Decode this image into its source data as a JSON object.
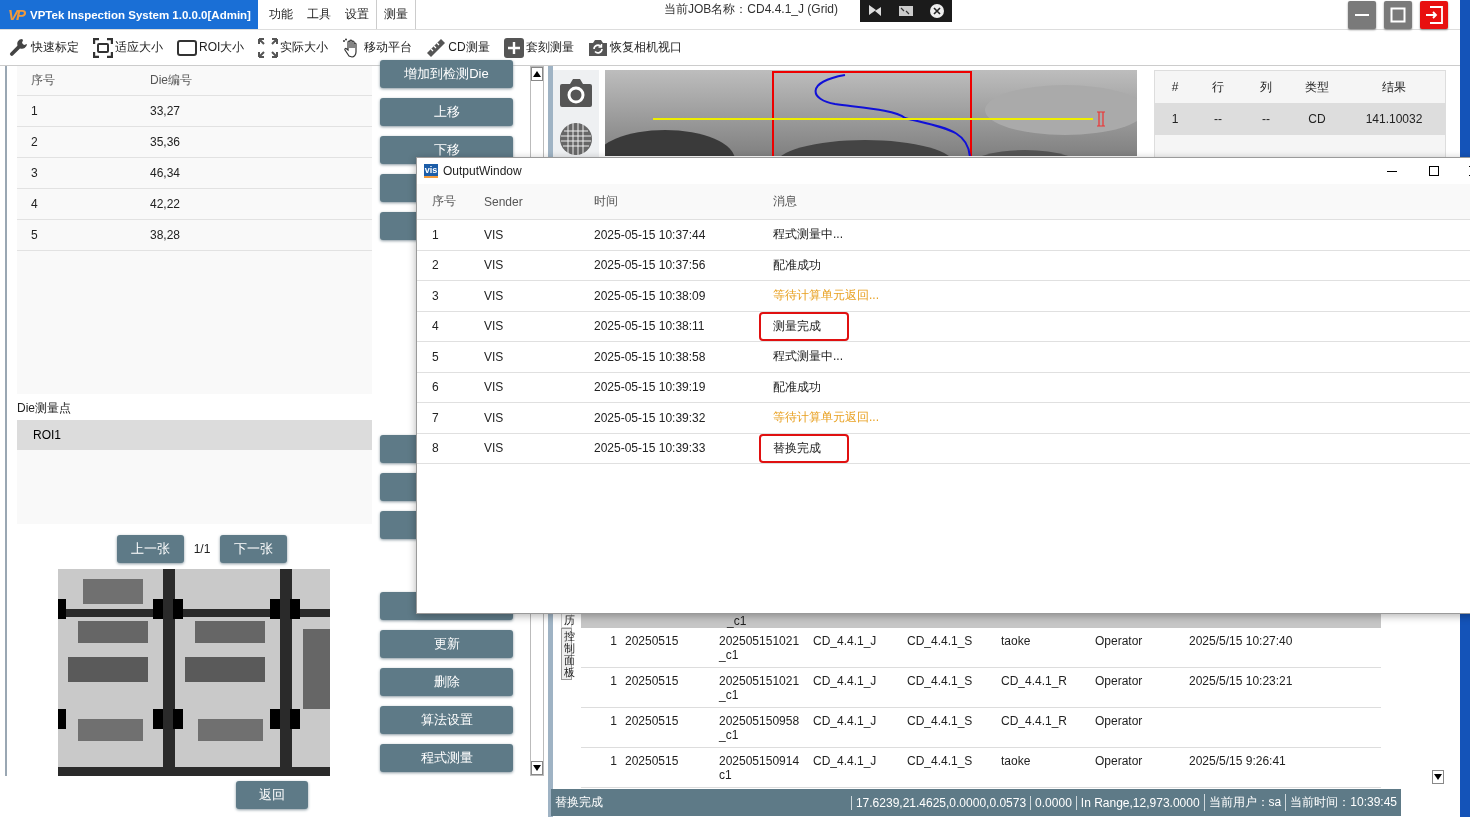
{
  "title_bar": {
    "logo": "VP",
    "app_title": "VPTek Inspection System 1.0.0.0[Admin]",
    "menu": [
      {
        "label": "功能",
        "selected": false
      },
      {
        "label": "工具",
        "selected": false
      },
      {
        "label": "设置",
        "selected": false
      },
      {
        "label": "测量",
        "selected": true
      }
    ],
    "job_label": "当前JOB名称：CD4.4.1_J (Grid)"
  },
  "toolbar": [
    {
      "kind": "wrench",
      "label": "快速标定"
    },
    {
      "kind": "fit",
      "label": "适应大小"
    },
    {
      "kind": "roi",
      "label": "ROI大小"
    },
    {
      "kind": "expand",
      "label": "实际大小"
    },
    {
      "kind": "hand",
      "label": "移动平台"
    },
    {
      "kind": "ruler",
      "label": "CD测量"
    },
    {
      "kind": "plus",
      "label": "套刻测量"
    },
    {
      "kind": "refresh",
      "label": "恢复相机视口"
    }
  ],
  "die_table": {
    "columns": [
      "序号",
      "Die编号"
    ],
    "rows": [
      [
        "1",
        "33,27"
      ],
      [
        "2",
        "35,36"
      ],
      [
        "3",
        "46,34"
      ],
      [
        "4",
        "42,22"
      ],
      [
        "5",
        "38,28"
      ]
    ]
  },
  "die_points": {
    "label": "Die测量点",
    "items": [
      {
        "label": "ROI1",
        "selected": true
      }
    ]
  },
  "pager": {
    "prev": "上一张",
    "page": "1/1",
    "next": "下一张"
  },
  "back_button": "返回",
  "action_groups": [
    [
      {
        "kind": "labeled",
        "label": "增加到检测Die"
      },
      {
        "kind": "labeled",
        "label": "上移"
      },
      {
        "kind": "labeled",
        "label": "下移"
      },
      {
        "kind": "covered"
      },
      {
        "kind": "covered"
      }
    ],
    [
      {
        "kind": "covered"
      },
      {
        "kind": "covered"
      },
      {
        "kind": "covered"
      }
    ],
    [
      {
        "kind": "covered"
      },
      {
        "kind": "labeled",
        "label": "更新"
      },
      {
        "kind": "labeled",
        "label": "删除"
      },
      {
        "kind": "labeled",
        "label": "算法设置"
      },
      {
        "kind": "labeled",
        "label": "程式测量"
      }
    ]
  ],
  "result_table": {
    "columns": [
      "#",
      "行",
      "列",
      "类型",
      "结果"
    ],
    "rows": [
      [
        "1",
        "--",
        "--",
        "CD",
        "141.10032"
      ]
    ]
  },
  "history": {
    "tabs": [
      {
        "label": "历",
        "selected": true
      },
      {
        "label": "控制面板",
        "selected": false
      }
    ],
    "partial_row": "_c1",
    "rows": [
      {
        "cells": [
          "1",
          "20250515",
          [
            "202505151021",
            "_c1"
          ],
          "CD_4.4.1_J",
          "CD_4.4.1_S",
          "taoke",
          "Operator",
          "2025/5/15 10:27:40"
        ]
      },
      {
        "cells": [
          "1",
          "20250515",
          [
            "202505151021",
            "_c1"
          ],
          "CD_4.4.1_J",
          "CD_4.4.1_S",
          "CD_4.4.1_R",
          "Operator",
          "2025/5/15 10:23:21"
        ]
      },
      {
        "cells": [
          "1",
          "20250515",
          [
            "202505150958",
            "_c1"
          ],
          "CD_4.4.1_J",
          "CD_4.4.1_S",
          "CD_4.4.1_R",
          "Operator",
          null
        ]
      },
      {
        "cells": [
          "1",
          "20250515",
          [
            "202505150914",
            "c1"
          ],
          "CD_4.4.1_J",
          "CD_4.4.1_S",
          "taoke",
          "Operator",
          "2025/5/15 9:26:41"
        ]
      }
    ]
  },
  "status_bar": {
    "message": "替换完成",
    "segments": [
      "17.6239,21.4625,0.0000,0.0573",
      "0.0000",
      "In Range,12,973.0000",
      "当前用户：sa",
      "当前时间：10:39:45"
    ]
  },
  "output_window": {
    "title": "OutputWindow",
    "icon_text": "vis",
    "columns": [
      "序号",
      "Sender",
      "时间",
      "消息"
    ],
    "rows": [
      {
        "index": "1",
        "sender": "VIS",
        "time": "2025-05-15 10:37:44",
        "message": "程式测量中...",
        "kind": "info",
        "circled": false
      },
      {
        "index": "2",
        "sender": "VIS",
        "time": "2025-05-15 10:37:56",
        "message": "配准成功",
        "kind": "info",
        "circled": false
      },
      {
        "index": "3",
        "sender": "VIS",
        "time": "2025-05-15 10:38:09",
        "message": "等待计算单元返回...",
        "kind": "warning",
        "circled": false
      },
      {
        "index": "4",
        "sender": "VIS",
        "time": "2025-05-15 10:38:11",
        "message": "测量完成",
        "kind": "info",
        "circled": true
      },
      {
        "index": "5",
        "sender": "VIS",
        "time": "2025-05-15 10:38:58",
        "message": "程式测量中...",
        "kind": "info",
        "circled": false
      },
      {
        "index": "6",
        "sender": "VIS",
        "time": "2025-05-15 10:39:19",
        "message": "配准成功",
        "kind": "info",
        "circled": false
      },
      {
        "index": "7",
        "sender": "VIS",
        "time": "2025-05-15 10:39:32",
        "message": "等待计算单元返回...",
        "kind": "warning",
        "circled": false
      },
      {
        "index": "8",
        "sender": "VIS",
        "time": "2025-05-15 10:39:33",
        "message": "替换完成",
        "kind": "info",
        "circled": true
      }
    ]
  }
}
